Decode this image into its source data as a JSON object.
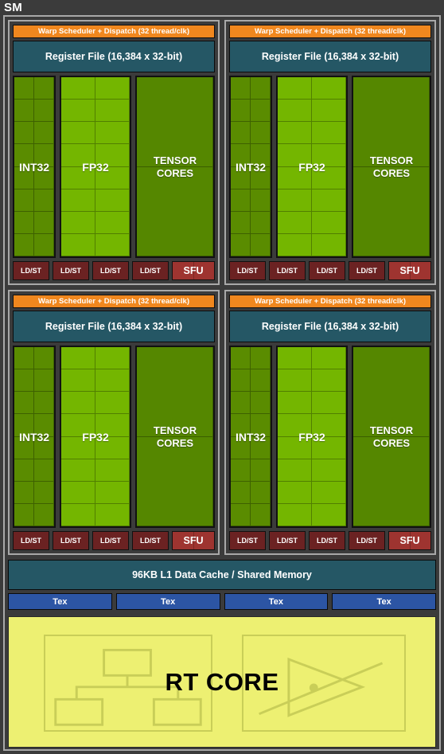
{
  "diagram": {
    "title": "SM",
    "colors": {
      "background": "#3b3b3b",
      "frame_border": "#a8a8a8",
      "warp_scheduler": "#f0871e",
      "register_file": "#255765",
      "int32": "#5a8c00",
      "fp32": "#74b600",
      "tensor_cores": "#558700",
      "ldst": "#6b2222",
      "sfu": "#9e3430",
      "l1_cache": "#255765",
      "tex": "#2c55a4",
      "rt_core": "#edf072",
      "rt_outline": "#c9ce58",
      "text_light": "#ffffff",
      "text_dark": "#000000"
    }
  },
  "processing_blocks": [
    {
      "warp_scheduler": "Warp Scheduler + Dispatch (32 thread/clk)",
      "register_file": "Register File (16,384 x 32-bit)",
      "units": [
        {
          "label": "INT32",
          "cols": 2,
          "rows": 8
        },
        {
          "label": "FP32",
          "cols": 2,
          "rows": 8
        },
        {
          "label": "TENSOR CORES",
          "label_line1": "TENSOR",
          "label_line2": "CORES",
          "cols": 1,
          "rows": 2
        }
      ],
      "ldst": [
        "LD/ST",
        "LD/ST",
        "LD/ST",
        "LD/ST"
      ],
      "sfu": "SFU"
    },
    {
      "warp_scheduler": "Warp Scheduler + Dispatch (32 thread/clk)",
      "register_file": "Register File (16,384 x 32-bit)",
      "units": [
        {
          "label": "INT32",
          "cols": 2,
          "rows": 8
        },
        {
          "label": "FP32",
          "cols": 2,
          "rows": 8
        },
        {
          "label": "TENSOR CORES",
          "label_line1": "TENSOR",
          "label_line2": "CORES",
          "cols": 1,
          "rows": 2
        }
      ],
      "ldst": [
        "LD/ST",
        "LD/ST",
        "LD/ST",
        "LD/ST"
      ],
      "sfu": "SFU"
    },
    {
      "warp_scheduler": "Warp Scheduler + Dispatch (32 thread/clk)",
      "register_file": "Register File (16,384 x 32-bit)",
      "units": [
        {
          "label": "INT32",
          "cols": 2,
          "rows": 8
        },
        {
          "label": "FP32",
          "cols": 2,
          "rows": 8
        },
        {
          "label": "TENSOR CORES",
          "label_line1": "TENSOR",
          "label_line2": "CORES",
          "cols": 1,
          "rows": 2
        }
      ],
      "ldst": [
        "LD/ST",
        "LD/ST",
        "LD/ST",
        "LD/ST"
      ],
      "sfu": "SFU"
    },
    {
      "warp_scheduler": "Warp Scheduler + Dispatch (32 thread/clk)",
      "register_file": "Register File (16,384 x 32-bit)",
      "units": [
        {
          "label": "INT32",
          "cols": 2,
          "rows": 8
        },
        {
          "label": "FP32",
          "cols": 2,
          "rows": 8
        },
        {
          "label": "TENSOR CORES",
          "label_line1": "TENSOR",
          "label_line2": "CORES",
          "cols": 1,
          "rows": 2
        }
      ],
      "ldst": [
        "LD/ST",
        "LD/ST",
        "LD/ST",
        "LD/ST"
      ],
      "sfu": "SFU"
    }
  ],
  "l1_cache": {
    "label": "96KB L1 Data Cache / Shared Memory"
  },
  "tex_units": [
    {
      "label": "Tex"
    },
    {
      "label": "Tex"
    },
    {
      "label": "Tex"
    },
    {
      "label": "Tex"
    }
  ],
  "rt_core": {
    "label": "RT CORE",
    "left_panel_icon": "bvh-tree-icon",
    "right_panel_icon": "ray-triangle-intersection-icon"
  }
}
